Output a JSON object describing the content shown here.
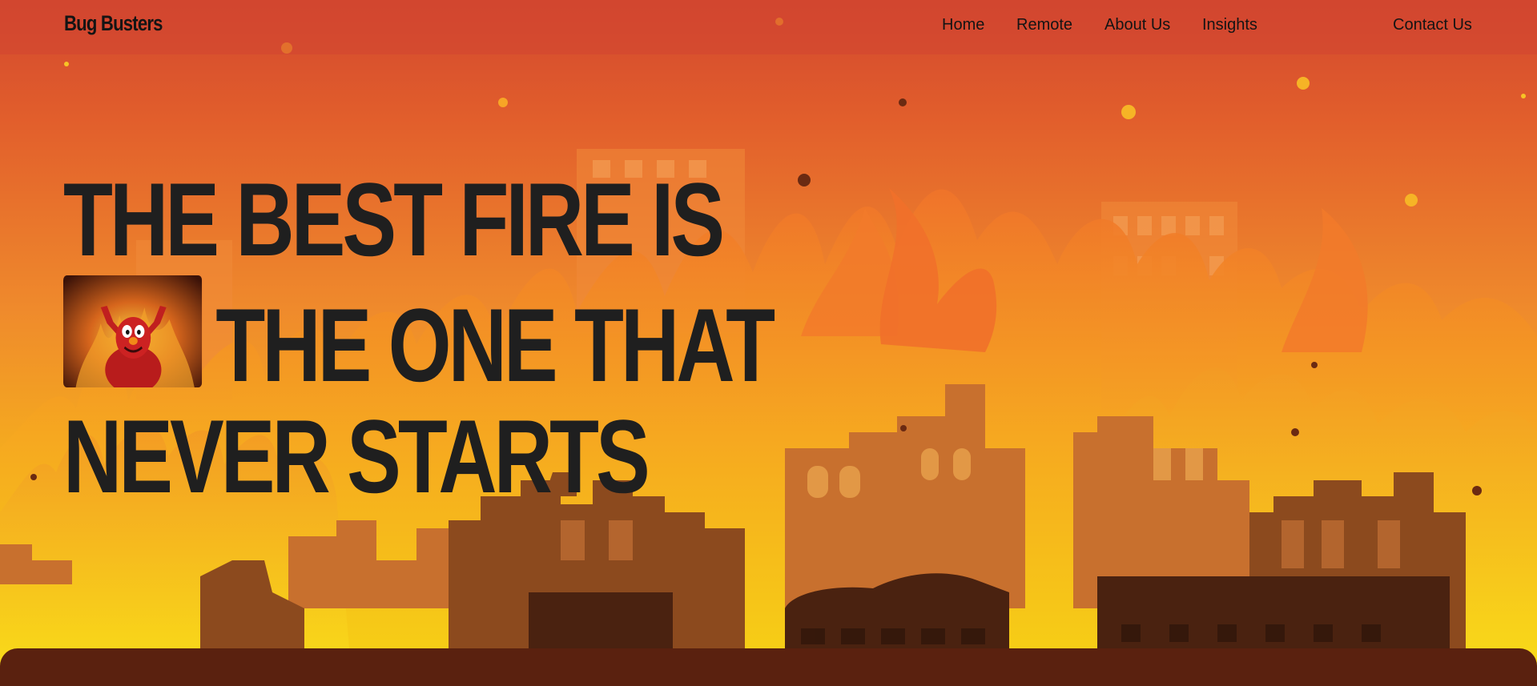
{
  "nav": {
    "logo": "Bug Busters",
    "links": [
      "Home",
      "Remote",
      "About Us",
      "Insights"
    ],
    "contact": "Contact Us"
  },
  "hero": {
    "headline_line1": "THE BEST FIRE IS",
    "headline_line2": "THE ONE THAT",
    "headline_line3": "NEVER STARTS",
    "image_description": "burning-red-puppet-thumbnail"
  },
  "colors": {
    "sky_top": "#d2472e",
    "fire_yellow": "#f3d017",
    "ruins": "#8a4a1f",
    "ruins_dark": "#4a2210",
    "headline_text": "#1f1f1f",
    "bottom_panel": "#5a210f"
  }
}
